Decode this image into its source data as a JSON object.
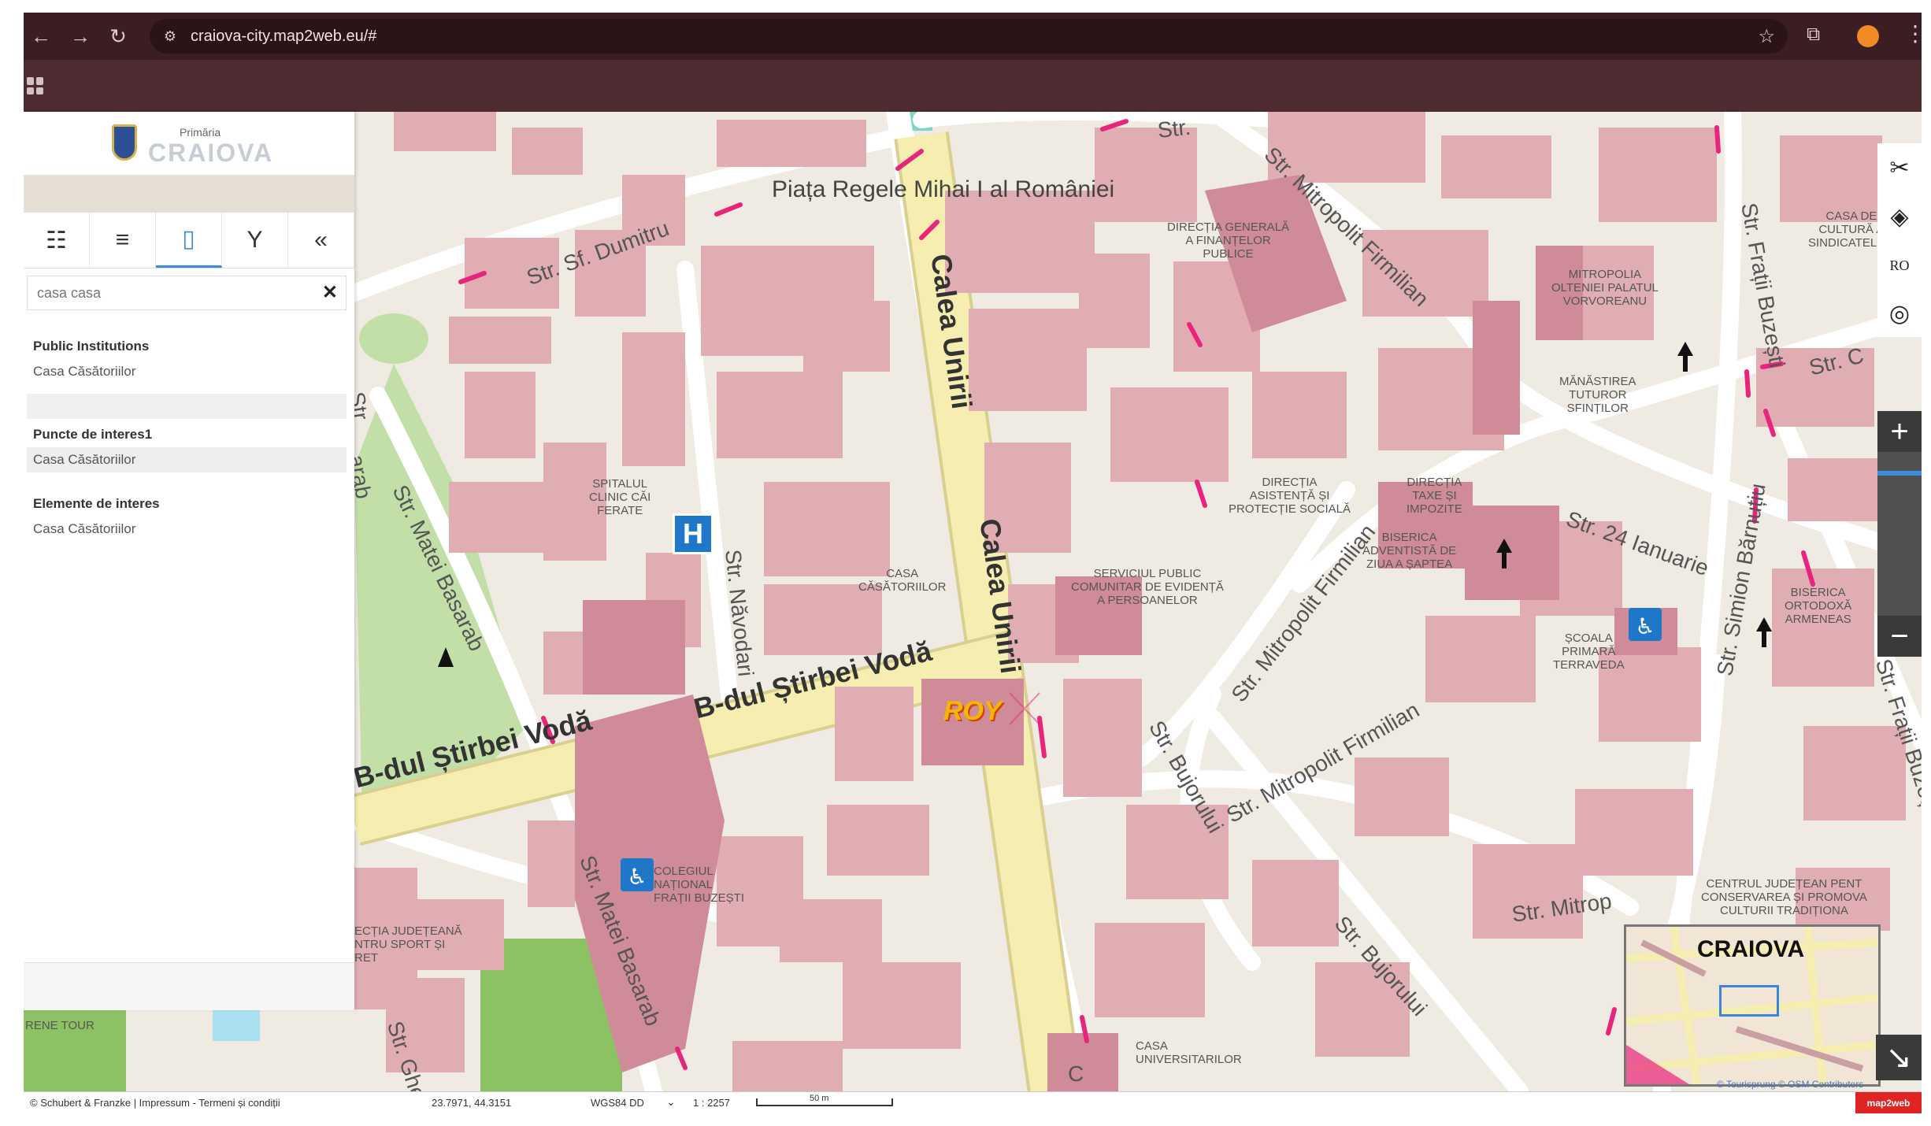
{
  "browser": {
    "url": "craiova-city.map2web.eu/#"
  },
  "sidebar": {
    "logo_small": "Primăria",
    "logo_big": "CRAIOVA",
    "tabs": [
      {
        "icon": "legend-list-icon"
      },
      {
        "icon": "menu-icon"
      },
      {
        "icon": "document-search-icon"
      },
      {
        "icon": "filter-icon"
      },
      {
        "icon": "collapse-icon"
      }
    ],
    "search": {
      "value": "casa casa"
    },
    "groups": [
      {
        "title": "Public Institutions",
        "items": [
          "Casa Căsătoriilor"
        ]
      },
      {
        "title": "Puncte de interes1",
        "items": [
          "Casa Căsătoriilor"
        ]
      },
      {
        "title": "Elemente de interes",
        "items": [
          "Casa Căsătoriilor"
        ]
      }
    ]
  },
  "map": {
    "square": "Piața Regele Mihai I al României",
    "streets": {
      "calea_unirii_1": "Calea Unirii",
      "calea_unirii_2": "Calea Unirii",
      "stirbei_1": "B-dul Știrbei Vodă",
      "stirbei_2": "B-dul Știrbei Vodă",
      "sf_dumitru": "Str. Sf. Dumitru",
      "mitropolit_1": "Str. Mitropolit Firmilian",
      "mitropolit_2": "Str. Mitropolit Firmilian",
      "mitropolit_3": "Str. Mitropolit Firmilian",
      "mitropolit_4": "Str. Mitrop",
      "matei_basarab_1": "Str. Matei Basarab",
      "matei_basarab_2": "Str. Matei Basarab",
      "navodari": "Str. Năvodari",
      "bujorului_1": "Str. Bujorului",
      "bujorului_2": "Str. Bujorului",
      "ianuarie": "Str. 24 Ianuarie",
      "simion_barnutiu": "Str. Simion Bărnuțiu",
      "frati_buzesti_1": "Str. Frații Buzești",
      "frati_buzesti_2": "Str. Frații Buzești",
      "str_c": "Str. C",
      "str_mi": "Str. Mi",
      "gheorg": "Str. Gheorg",
      "top_str": "Str.",
      "cut_left": "Str",
      "cut_left2": "arab",
      "c_edge": "C"
    },
    "pois": {
      "spitalul": "SPITALUL\nCLINIC CĂI\nFERATE",
      "casa_casatoriilor": "CASA\nCĂSĂTORIILOR",
      "directia_finante": "DIRECȚIA GENERALĂ\nA FINANȚELOR\nPUBLICE",
      "mitropolia": "MITROPOLIA\nOLTENIEI PALATUL\nVORVOREANU",
      "manastirea": "MĂNĂSTIREA\nTUTUROR\nSFINȚILOR",
      "asistenta": "DIRECȚIA\nASISTENȚĂ ȘI\nPROTECȚIE SOCIALĂ",
      "taxe": "DIRECȚIA\nTAXE ȘI\nIMPOZITE",
      "adventista": "BISERICA\nADVENTISTĂ DE\nZIUA A ȘAPTEA",
      "serviciul": "SERVICIUL PUBLIC\nCOMUNITAR DE EVIDENȚĂ\nA PERSOANELOR",
      "scoala": "ȘCOALA\nPRIMARĂ\nTERRAVEDA",
      "biserica_ortodoxa": "BISERICA\nORTODOXĂ\nARMENEAS",
      "casa_cultura": "CASA DE\nCULTURĂ A\nSINDICATELOR",
      "colegiul": "COLEGIUL\nNAȚIONAL\nFRAȚII BUZEȘTI",
      "directia_sport": "ECȚIA JUDEȚEANĂ\nNTRU SPORT ȘI\nRET",
      "centrul": "CENTRUL JUDEȚEAN PENT\nCONSERVAREA ȘI PROMOVA\nCULTURII TRADIȚIONA",
      "casa_universitarilor": "CASA\nUNIVERSITARILOR",
      "teren": "RENE TOUR"
    },
    "hospital_symbol": "H",
    "roy_logo": "ROY",
    "minimap_title": "CRAIOVA",
    "right_tools": {
      "lang": "RO"
    },
    "zoom_in": "+",
    "zoom_out": "−",
    "minimap_toggle": "↘"
  },
  "statusbar": {
    "copyright": "© Schubert & Franzke | Impressum - Termeni și condiții",
    "coords": "23.7971, 44.3151",
    "crs": "WGS84 DD",
    "scale": "1 : 2257",
    "scale_bar_label": "50 m",
    "brand": "map2web",
    "credit": "© Tourisprung © OSM Contributors"
  },
  "colors": {
    "building": "#e0aeb2",
    "building_dark": "#cf8b98",
    "major_road": "#f5eeb0",
    "park": "#c3dfa8",
    "accent": "#3a8bd8"
  }
}
